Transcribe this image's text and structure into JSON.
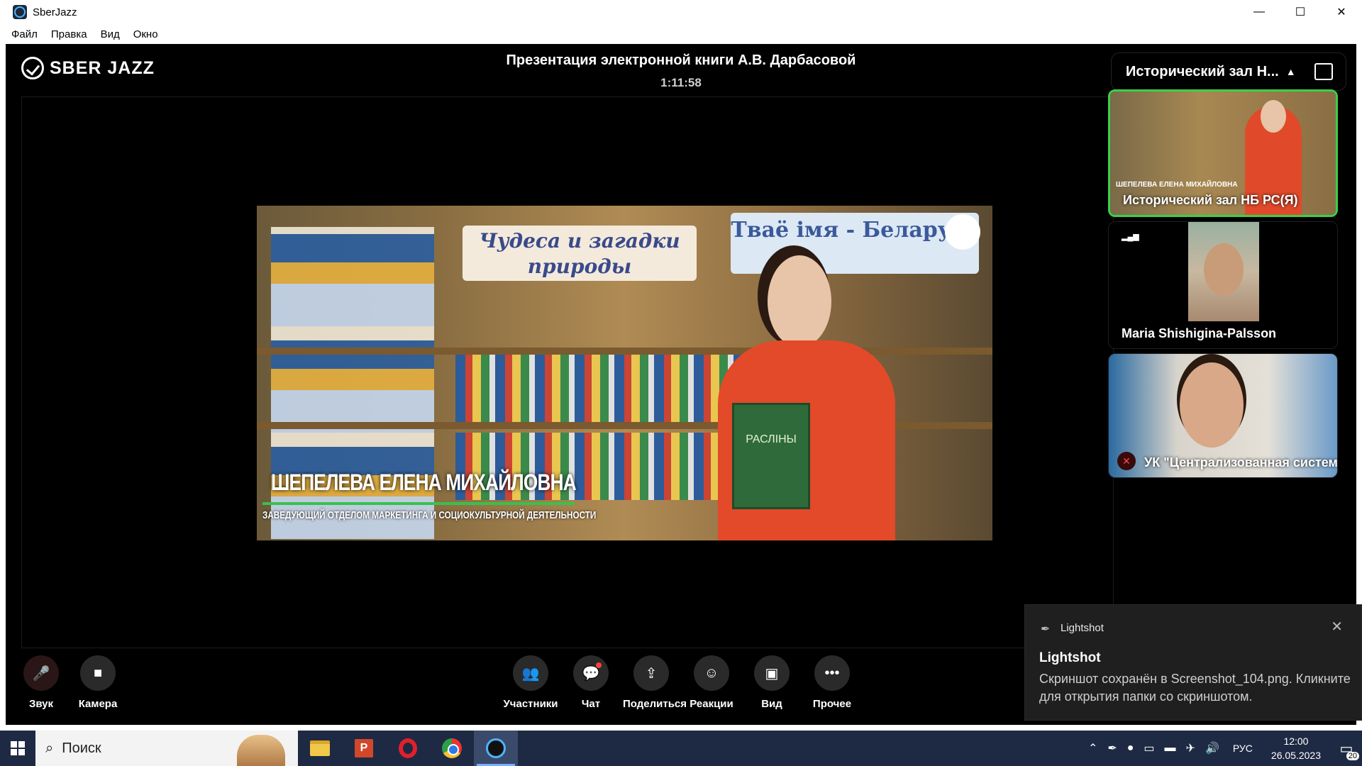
{
  "window": {
    "title": "SberJazz",
    "minimize": "—",
    "maximize": "☐",
    "close": "✕"
  },
  "menu": [
    "Файл",
    "Правка",
    "Вид",
    "Окно"
  ],
  "logo": {
    "text": "SBER JAZZ"
  },
  "meeting": {
    "title": "Презентация электронной книги А.В. Дарбасовой",
    "duration": "1:11:58"
  },
  "video": {
    "banner_left": "Чудеса и загадки природы",
    "banner_right": "Тваё імя - Беларусь",
    "book_title": "РАСЛІНЫ",
    "caption_name": "ШЕПЕЛЕВА ЕЛЕНА МИХАЙЛОВНА",
    "caption_role": "ЗАВЕДУЮЩИЙ ОТДЕЛОМ МАРКЕТИНГА И СОЦИОКУЛЬТУРНОЙ ДЕЯТЕЛЬНОСТИ"
  },
  "panel": {
    "room_name": "Исторический зал Н...",
    "tiles": [
      {
        "name": "Исторический зал НБ РС(Я)",
        "thumb_text": "ШЕПЕЛЕВА ЕЛЕНА МИХАЙЛОВНА",
        "active": true
      },
      {
        "name": "Maria Shishigina-Palsson",
        "active": false
      },
      {
        "name": "УК \"Централизованная систем",
        "active": false,
        "muted": true
      }
    ]
  },
  "toolbar": {
    "sound": "Звук",
    "camera": "Камера",
    "participants": "Участники",
    "chat": "Чат",
    "share": "Поделиться",
    "reactions": "Реакции",
    "view": "Вид",
    "more": "Прочее"
  },
  "toast": {
    "app": "Lightshot",
    "title": "Lightshot",
    "body": "Скриншот сохранён в Screenshot_104.png. Кликните для открытия папки со скриншотом."
  },
  "taskbar": {
    "search_placeholder": "Поиск",
    "language": "РУС",
    "time": "12:00",
    "date": "26.05.2023",
    "notification_count": "20"
  }
}
